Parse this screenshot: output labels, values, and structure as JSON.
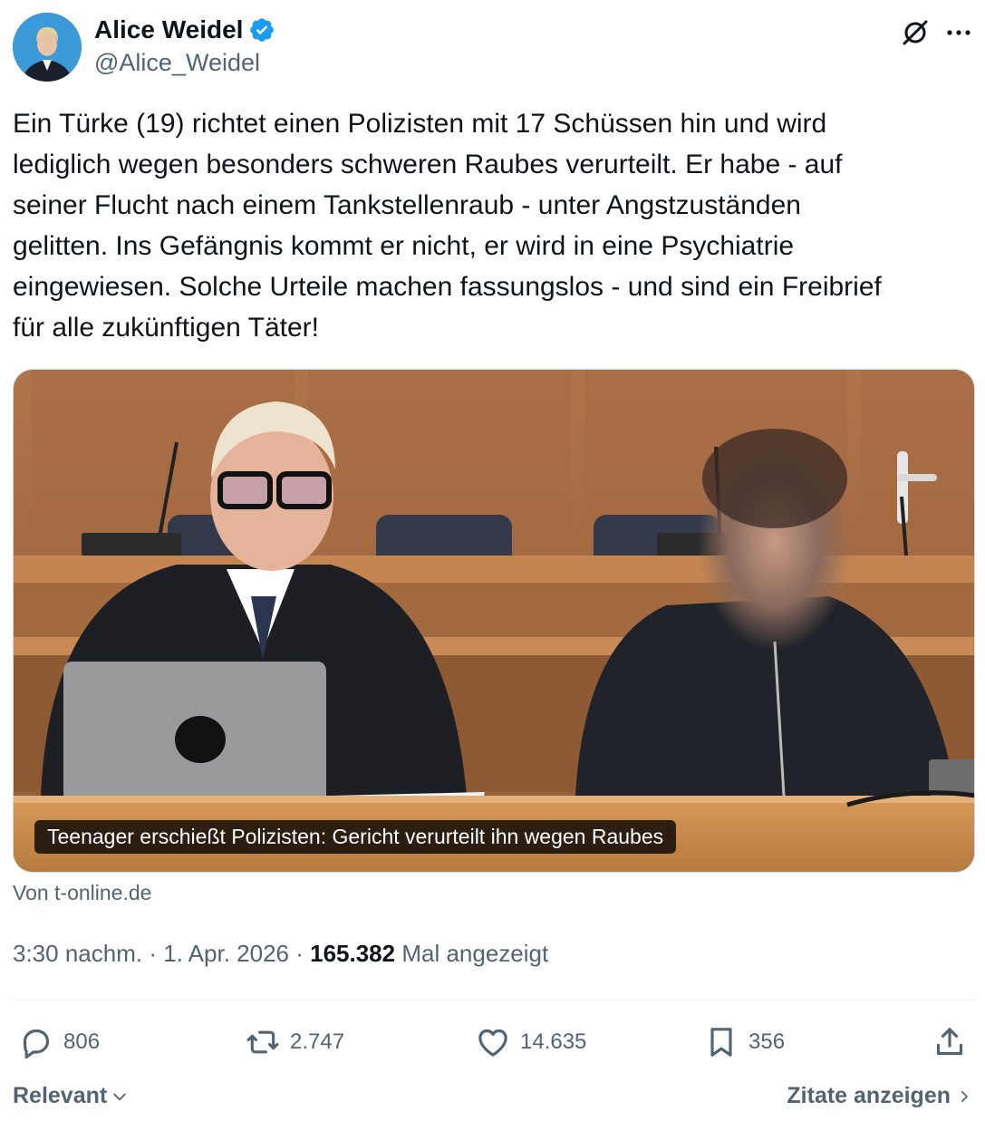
{
  "author": {
    "display_name": "Alice Weidel",
    "handle": "@Alice_Weidel",
    "verified": true,
    "verified_color": "#1d9bf0"
  },
  "header_icons": [
    "grok-icon",
    "more-icon"
  ],
  "tweet": {
    "text": "Ein Türke (19) richtet einen Polizisten mit 17 Schüssen hin und wird\nlediglich wegen besonders schweren Raubes verurteilt. Er habe - auf\nseiner Flucht nach einem Tankstellenraub - unter Angstzuständen\ngelitten. Ins Gefängnis kommt er nicht, er wird in eine Psychiatrie\neingewiesen. Solche Urteile machen fassungslos - und sind ein Freibrief\nfür alle zukünftigen Täter!"
  },
  "link_card": {
    "caption": "Teenager erschießt Polizisten: Gericht verurteilt ihn wegen Raubes",
    "source": "Von t-online.de"
  },
  "meta": {
    "time": "3:30 nachm.",
    "separator": " · ",
    "date": "1. Apr. 2026",
    "views_count": "165.382",
    "views_label": "Mal angezeigt"
  },
  "actions": {
    "replies": "806",
    "reposts": "2.747",
    "likes": "14.635",
    "bookmarks": "356"
  },
  "footer": {
    "sort_label": "Relevant",
    "quotes_label": "Zitate anzeigen"
  },
  "colors": {
    "text_primary": "#0f1419",
    "text_secondary": "#536471",
    "divider": "#eff3f4",
    "accent": "#1d9bf0"
  }
}
